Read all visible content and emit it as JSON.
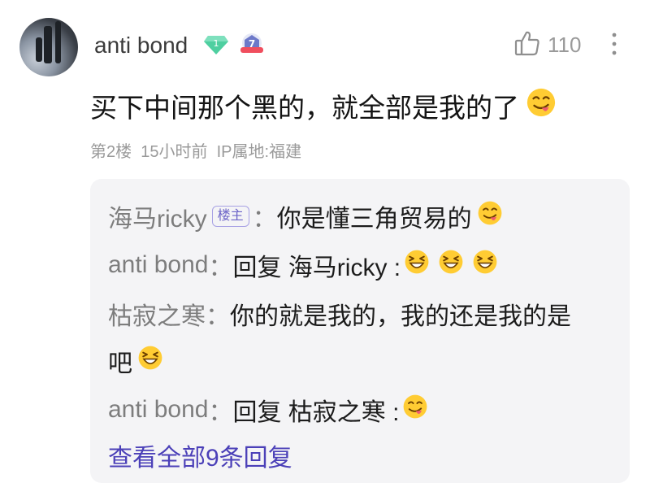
{
  "post": {
    "username": "anti bond",
    "level_badge": "1",
    "rank_badge": "7",
    "like_count": "110",
    "content": "买下中间那个黑的，就全部是我的了",
    "floor": "第2楼",
    "time": "15小时前",
    "ip": "IP属地:福建"
  },
  "replies": [
    {
      "name": "海马ricky",
      "tag": "楼主",
      "sep": "：",
      "text": "你是懂三角贸易的"
    },
    {
      "name": "anti bond",
      "sep": "：",
      "text": "回复 海马ricky :"
    },
    {
      "name": "枯寂之寒",
      "sep": "：",
      "text": "你的就是我的，我的还是我的是",
      "text2": "吧"
    },
    {
      "name": "anti bond",
      "sep": "：",
      "text": "回复 枯寂之寒 :"
    }
  ],
  "view_all": "查看全部9条回复",
  "colors": {
    "link": "#4b40b8",
    "meta": "#9a9a9a",
    "name": "#7d7d7d",
    "reply_bg": "#f4f4f6"
  },
  "icons": [
    "avatar-image",
    "level-diamond-icon",
    "rank-seven-icon",
    "thumbs-up-icon",
    "more-vertical-icon",
    "yum-emoji",
    "grin-squint-emoji"
  ]
}
